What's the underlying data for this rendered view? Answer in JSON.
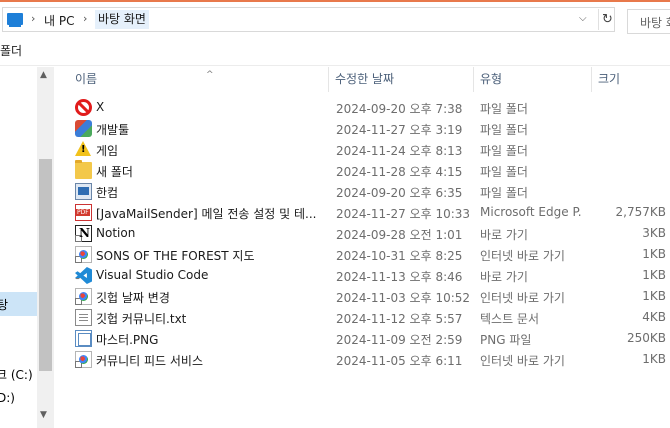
{
  "address": {
    "crumbs": [
      "내 PC",
      "바탕 화면"
    ],
    "separator": "›",
    "refresh_glyph": "↻",
    "dropdown_glyph": "⌵"
  },
  "search": {
    "placeholder": "바탕 화"
  },
  "toolbar": {
    "new_folder_label": "폴더"
  },
  "nav": {
    "selected_label": "탕",
    "drive_c": "크 (C:)",
    "drive_d": "D:)",
    "scroll_up": "▲",
    "scroll_down": "▼"
  },
  "columns": {
    "name": "이름",
    "modified": "수정한 날짜",
    "type": "유형",
    "size": "크기",
    "sort_glyph": "^"
  },
  "files": [
    {
      "icon": "no-entry-icon",
      "name": "X",
      "date": "2024-09-20 오후 7:38",
      "type": "파일 폴더",
      "size": ""
    },
    {
      "icon": "colorful-folder-icon",
      "name": "개발툴",
      "date": "2024-11-27 오후 3:19",
      "type": "파일 폴더",
      "size": ""
    },
    {
      "icon": "warning-icon",
      "name": "게임",
      "date": "2024-11-24 오후 8:13",
      "type": "파일 폴더",
      "size": ""
    },
    {
      "icon": "folder-icon",
      "name": "새 폴더",
      "date": "2024-11-28 오후 4:15",
      "type": "파일 폴더",
      "size": ""
    },
    {
      "icon": "hancom-icon",
      "name": "한컴",
      "date": "2024-09-20 오후 6:35",
      "type": "파일 폴더",
      "size": ""
    },
    {
      "icon": "pdf-icon",
      "name": "[JavaMailSender] 메일 전송 설정 및 테...",
      "date": "2024-11-27 오후 10:33",
      "type": "Microsoft Edge P...",
      "size": "2,757KB"
    },
    {
      "icon": "notion-icon",
      "name": "Notion",
      "date": "2024-09-28 오전 1:01",
      "type": "바로 가기",
      "size": "3KB"
    },
    {
      "icon": "internet-shortcut-icon",
      "name": "SONS OF THE FOREST 지도",
      "date": "2024-10-31 오후 8:25",
      "type": "인터넷 바로 가기",
      "size": "1KB"
    },
    {
      "icon": "vscode-icon",
      "name": "Visual Studio Code",
      "date": "2024-11-13 오후 8:46",
      "type": "바로 가기",
      "size": "1KB"
    },
    {
      "icon": "internet-shortcut-icon",
      "name": "깃헙 날짜 변경",
      "date": "2024-11-03 오후 10:52",
      "type": "인터넷 바로 가기",
      "size": "1KB"
    },
    {
      "icon": "text-file-icon",
      "name": "깃헙 커뮤니티.txt",
      "date": "2024-11-12 오후 5:57",
      "type": "텍스트 문서",
      "size": "4KB"
    },
    {
      "icon": "png-file-icon",
      "name": "마스터.PNG",
      "date": "2024-11-09 오전 2:59",
      "type": "PNG 파일",
      "size": "250KB"
    },
    {
      "icon": "internet-shortcut-icon",
      "name": "커뮤니티 피드 서비스",
      "date": "2024-11-05 오후 6:11",
      "type": "인터넷 바로 가기",
      "size": "1KB"
    }
  ],
  "colors": {
    "accent_top": "#e8794b",
    "selection": "#cce4f7",
    "header_text": "#4c607a"
  }
}
